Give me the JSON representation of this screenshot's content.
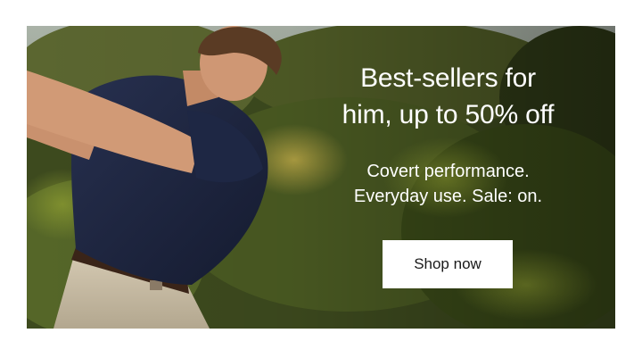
{
  "banner": {
    "headline_line1": "Best-sellers for",
    "headline_line2": "him, up to 50% off",
    "subline_line1": "Covert performance.",
    "subline_line2": "Everyday use. Sale: on.",
    "cta_label": "Shop now"
  },
  "colors": {
    "headline_text": "#ffffff",
    "cta_background": "#ffffff",
    "cta_text": "#1a1a1a",
    "shirt": "#1c2440",
    "foliage": "#4a5a22"
  }
}
